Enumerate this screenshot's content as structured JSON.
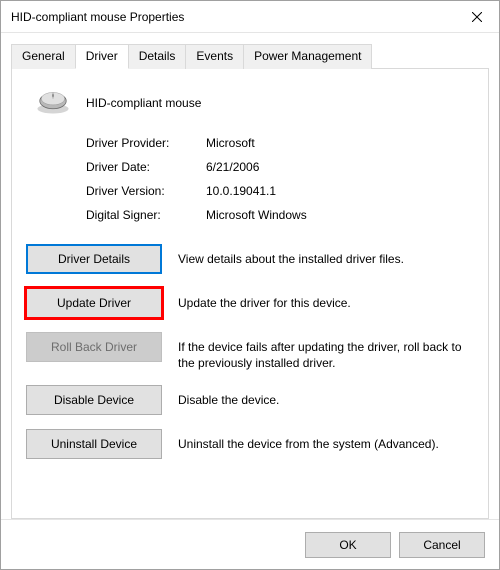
{
  "window": {
    "title": "HID-compliant mouse Properties"
  },
  "tabs": {
    "general": "General",
    "driver": "Driver",
    "details": "Details",
    "events": "Events",
    "power": "Power Management",
    "active": "driver"
  },
  "device": {
    "name": "HID-compliant mouse"
  },
  "info": {
    "provider_label": "Driver Provider:",
    "provider_value": "Microsoft",
    "date_label": "Driver Date:",
    "date_value": "6/21/2006",
    "version_label": "Driver Version:",
    "version_value": "10.0.19041.1",
    "signer_label": "Digital Signer:",
    "signer_value": "Microsoft Windows"
  },
  "actions": {
    "details": {
      "label": "Driver Details",
      "desc": "View details about the installed driver files."
    },
    "update": {
      "label": "Update Driver",
      "desc": "Update the driver for this device."
    },
    "rollback": {
      "label": "Roll Back Driver",
      "desc": "If the device fails after updating the driver, roll back to the previously installed driver."
    },
    "disable": {
      "label": "Disable Device",
      "desc": "Disable the device."
    },
    "uninstall": {
      "label": "Uninstall Device",
      "desc": "Uninstall the device from the system (Advanced)."
    }
  },
  "footer": {
    "ok": "OK",
    "cancel": "Cancel"
  }
}
